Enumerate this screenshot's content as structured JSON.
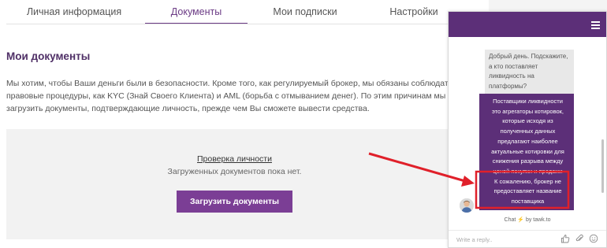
{
  "tabs": [
    {
      "label": "Личная информация",
      "active": false
    },
    {
      "label": "Документы",
      "active": true
    },
    {
      "label": "Мои подписки",
      "active": false
    },
    {
      "label": "Настройки",
      "active": false
    }
  ],
  "documents": {
    "title": "Мои документы",
    "intro_lines": [
      "Мы хотим, чтобы Ваши деньги были в безопасности. Кроме того, как регулируемый брокер, мы обязаны соблюдать такие",
      "правовые процедуры, как KYC (Знай Своего Клиента) и AML (борьба с отмыванием денег). По этим причинам мы просим Вас",
      "загрузить документы, подтверждающие личность, прежде чем Вы сможете вывести средства."
    ],
    "verify_link": "Проверка личности",
    "no_docs": "Загруженных документов пока нет.",
    "upload_button": "Загрузить документы"
  },
  "chat": {
    "user_message": "Добрый день. Подскажите, а кто поставляет ликвидность на платформы?",
    "agent_message_lines": [
      "Поставщики ликвидности",
      "это агрегаторы котировок,",
      "которые исходя из",
      "полученных данных",
      "предлагают наиболее",
      "актуальные котировки для",
      "снижения разрыва между",
      "ценой покупки и продажи"
    ],
    "agent_message_highlight": "К сожалению, брокер не предоставляет название поставщика",
    "powered_prefix": "Chat",
    "powered_suffix": "by tawk.to",
    "reply_placeholder": "Write a reply..",
    "header_color": "#5c2f78",
    "highlight_color": "#e0202a"
  },
  "icons": [
    "menu-icon",
    "avatar-icon",
    "lightning-icon",
    "thumbs-up-icon",
    "attach-icon",
    "emoji-icon",
    "arrow-icon"
  ]
}
